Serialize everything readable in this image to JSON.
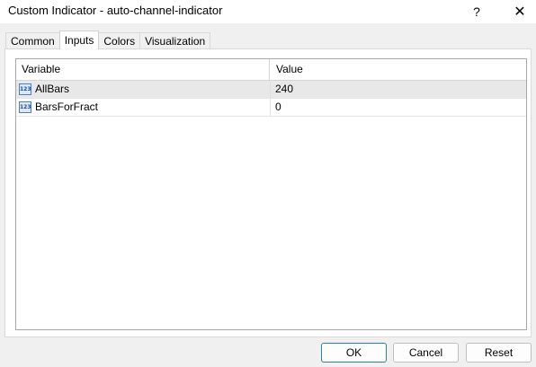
{
  "window": {
    "title": "Custom Indicator - auto-channel-indicator",
    "help_glyph": "?",
    "close_glyph": "✕"
  },
  "tabs": [
    {
      "label": "Common"
    },
    {
      "label": "Inputs",
      "active": true
    },
    {
      "label": "Colors"
    },
    {
      "label": "Visualization"
    }
  ],
  "table": {
    "columns": [
      "Variable",
      "Value"
    ],
    "rows": [
      {
        "icon": "numeric-123-icon",
        "icon_text": "123",
        "variable": "AllBars",
        "value": "240",
        "selected": true
      },
      {
        "icon": "numeric-123-icon",
        "icon_text": "123",
        "variable": "BarsForFract",
        "value": "0",
        "selected": false
      }
    ]
  },
  "buttons": {
    "ok": "OK",
    "cancel": "Cancel",
    "reset": "Reset"
  },
  "colors": {
    "window_bg": "#f0f0f0",
    "selected_row": "#e8e8e8",
    "default_button_border": "#2b7fa8"
  }
}
